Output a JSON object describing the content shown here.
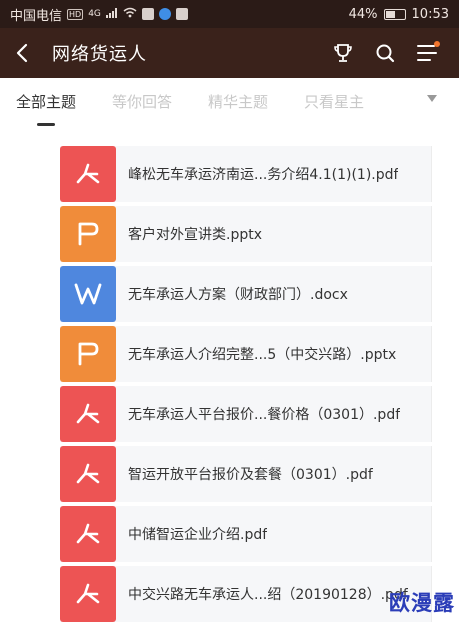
{
  "status_bar": {
    "carrier": "中国电信",
    "hd": "HD",
    "signal": "4G",
    "battery": "44%",
    "time": "10:53"
  },
  "header": {
    "title": "网络货运人",
    "icons": [
      "back-icon",
      "trophy-icon",
      "search-icon",
      "menu-icon"
    ],
    "notification_dot_color": "#f3762f"
  },
  "tabs": [
    {
      "label": "全部主题",
      "active": true
    },
    {
      "label": "等你回答",
      "active": false
    },
    {
      "label": "精华主题",
      "active": false
    },
    {
      "label": "只看星主",
      "active": false
    }
  ],
  "files": [
    {
      "name": "峰松无车承运济南运...务介绍4.1(1)(1).pdf",
      "type": "pdf"
    },
    {
      "name": "客户对外宣讲类.pptx",
      "type": "ppt"
    },
    {
      "name": "无车承运人方案（财政部门）.docx",
      "type": "doc"
    },
    {
      "name": "无车承运人介绍完整...5（中交兴路）.pptx",
      "type": "ppt"
    },
    {
      "name": "无车承运人平台报价...餐价格（0301）.pdf",
      "type": "pdf"
    },
    {
      "name": "智运开放平台报价及套餐（0301）.pdf",
      "type": "pdf"
    },
    {
      "name": "中储智运企业介绍.pdf",
      "type": "pdf"
    },
    {
      "name": "中交兴路无车承运人...绍（20190128）.pdf",
      "type": "pdf"
    }
  ],
  "colors": {
    "pdf": "#ed5454",
    "ppt": "#f08c3a",
    "doc": "#4f87de",
    "header_bg": "#3a221b"
  },
  "watermark": "欧漫露"
}
